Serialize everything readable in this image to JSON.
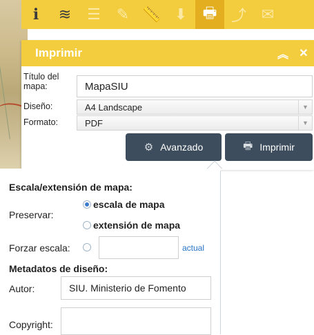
{
  "toolbar": {
    "items": [
      {
        "icon": "info-cursor-icon",
        "glyph": "ℹ"
      },
      {
        "icon": "layers-icon",
        "glyph": "≋"
      },
      {
        "icon": "legend-list-icon",
        "glyph": "☰"
      },
      {
        "icon": "map-draw-icon",
        "glyph": "✎"
      },
      {
        "icon": "ruler-icon",
        "glyph": "📏"
      },
      {
        "icon": "map-download-icon",
        "glyph": "⬇"
      },
      {
        "icon": "print-icon",
        "glyph": "🖶"
      },
      {
        "icon": "share-icon",
        "glyph": "⤴"
      },
      {
        "icon": "mail-icon",
        "glyph": "✉"
      }
    ],
    "active": "print-icon",
    "color": "#f3cd3e"
  },
  "panel": {
    "title": "Imprimir",
    "collapse_glyph": "︽",
    "close_glyph": "✕",
    "map_title_label": "Título del mapa:",
    "map_title_value": "MapaSIU",
    "layout_label": "Diseño:",
    "layout_value": "A4 Landscape",
    "format_label": "Formato:",
    "format_value": "PDF",
    "advanced_button": "Avanzado",
    "print_button": "Imprimir",
    "button_color": "#3d4d5d"
  },
  "advanced": {
    "scale_heading": "Escala/extensión de mapa:",
    "preserve_label": "Preservar:",
    "option_scale": "escala de mapa",
    "option_extent": "extensión de mapa",
    "preserve_selected": "escala de mapa",
    "force_scale_label": "Forzar escala:",
    "force_scale_value": "",
    "current_link": "actual",
    "metadata_heading": "Metadatos de diseño:",
    "author_label": "Autor:",
    "author_value": "SIU. Ministerio de Fomento",
    "copyright_label": "Copyright:",
    "copyright_value": ""
  }
}
